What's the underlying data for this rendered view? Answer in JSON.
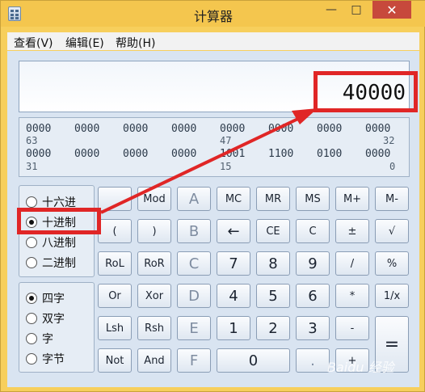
{
  "window": {
    "title": "计算器",
    "controls": {
      "minimize": "—",
      "maximize": "□",
      "close": "✕"
    }
  },
  "menu": [
    "查看(V)",
    "编辑(E)",
    "帮助(H)"
  ],
  "display": {
    "value": "40000"
  },
  "bits": {
    "row1": [
      "0000",
      "0000",
      "0000",
      "0000",
      "0000",
      "0000",
      "0000",
      "0000"
    ],
    "row1_index": [
      "63",
      "47",
      "32"
    ],
    "row2": [
      "0000",
      "0000",
      "0000",
      "0000",
      "1001",
      "1100",
      "0100",
      "0000"
    ],
    "row2_index": [
      "31",
      "15",
      "0"
    ]
  },
  "radix": {
    "options": [
      "十六进",
      "十进制",
      "八进制",
      "二进制"
    ],
    "selected": "十进制"
  },
  "word": {
    "options": [
      "四字",
      "双字",
      "字",
      "字节"
    ],
    "selected": "四字"
  },
  "keys": {
    "mod": "Mod",
    "A": "A",
    "MC": "MC",
    "MR": "MR",
    "MS": "MS",
    "Mplus": "M+",
    "Mminus": "M-",
    "lparen": "(",
    "rparen": ")",
    "B": "B",
    "back": "←",
    "CE": "CE",
    "C": "C",
    "plusminus": "±",
    "sqrt": "√",
    "RoL": "RoL",
    "RoR": "RoR",
    "Ckey": "C",
    "n7": "7",
    "n8": "8",
    "n9": "9",
    "div": "/",
    "pct": "%",
    "Or": "Or",
    "Xor": "Xor",
    "D": "D",
    "n4": "4",
    "n5": "5",
    "n6": "6",
    "mul": "*",
    "recip": "1/x",
    "Lsh": "Lsh",
    "Rsh": "Rsh",
    "E": "E",
    "n1": "1",
    "n2": "2",
    "n3": "3",
    "minus": "-",
    "eq": "=",
    "Not": "Not",
    "And": "And",
    "F": "F",
    "n0": "0",
    "dot": ".",
    "plus": "+"
  },
  "watermark": "Baidu 经验",
  "colors": {
    "annotation": "#e02626",
    "titlebar": "#f4c64e",
    "close": "#c7493c"
  }
}
